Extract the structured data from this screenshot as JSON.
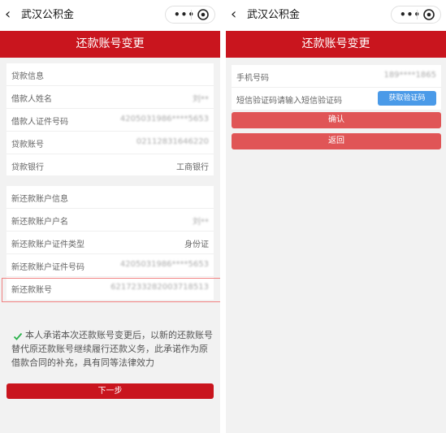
{
  "left": {
    "app_title": "武汉公积金",
    "page_title": "还款账号变更",
    "loan_section_title": "贷款信息",
    "loan_rows": [
      {
        "label": "借款人姓名",
        "value": "刘**"
      },
      {
        "label": "借款人证件号码",
        "value": "4205031986****5653"
      },
      {
        "label": "贷款账号",
        "value": "02112831646220"
      },
      {
        "label": "贷款银行",
        "value": "工商银行"
      }
    ],
    "new_section_title": "新还款账户信息",
    "new_rows": [
      {
        "label": "新还款账户户名",
        "value": "刘**"
      },
      {
        "label": "新还款账户证件类型",
        "value": "身份证"
      },
      {
        "label": "新还款账户证件号码",
        "value": "4205031986****5653"
      },
      {
        "label": "新还款账号",
        "value": "6217233282003718513"
      }
    ],
    "promise_text": "本人承诺本次还款账号变更后，以新的还款账号替代原还款账号继续履行还款义务，此承诺作为原借款合同的补充，具有同等法律效力",
    "next_label": "下一步"
  },
  "right": {
    "app_title": "武汉公积金",
    "page_title": "还款账号变更",
    "phone_label": "手机号码",
    "phone_value": "189****1865",
    "sms_label": "短信验证码",
    "sms_placeholder": "请输入短信验证码",
    "get_code_label": "获取验证码",
    "confirm_label": "确认",
    "back_label": "返回"
  },
  "icons": {
    "back": "chevron-left-icon",
    "more": "more-dots-icon",
    "close": "target-circle-icon",
    "check": "checkmark-icon"
  },
  "colors": {
    "brand_red": "#c9151e",
    "pink_button": "#e05556",
    "blue_button": "#4a9ae8",
    "check_green": "#2bb24c"
  }
}
